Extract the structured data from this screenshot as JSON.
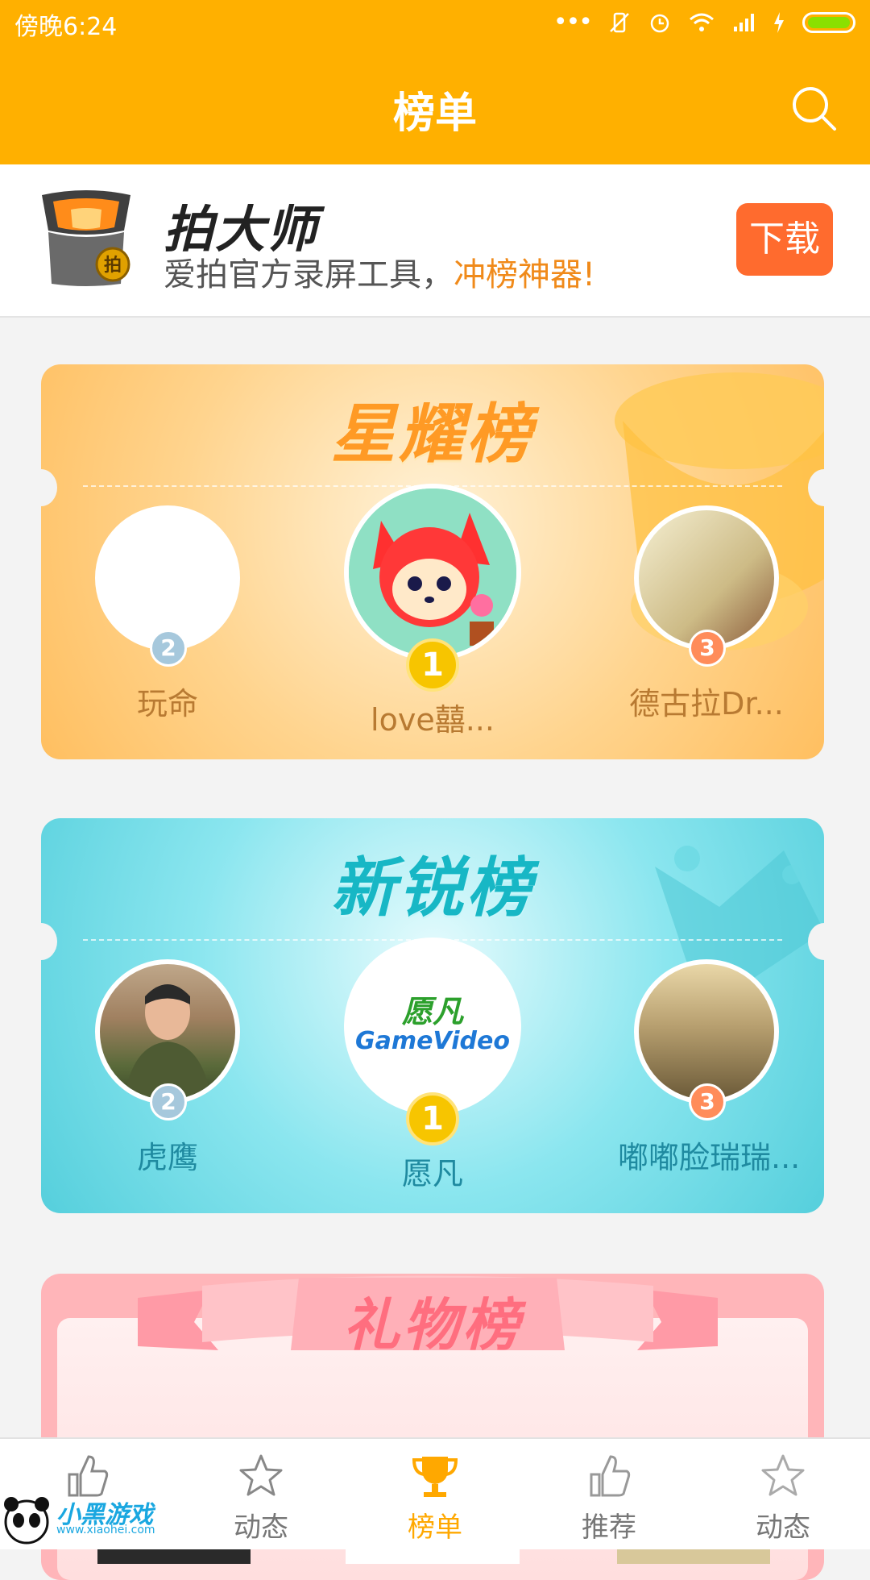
{
  "status": {
    "time": "傍晚6:24"
  },
  "header": {
    "title": "榜单"
  },
  "promo": {
    "name": "拍大师",
    "desc_main": "爱拍官方录屏工具，",
    "desc_highlight": "冲榜神器!",
    "download_label": "下载",
    "logo_badge": "拍"
  },
  "boards": [
    {
      "title": "星耀榜",
      "entries": [
        {
          "rank": "2",
          "name": "玩命"
        },
        {
          "rank": "1",
          "name": "love囍..."
        },
        {
          "rank": "3",
          "name": "德古拉Dr..."
        }
      ]
    },
    {
      "title": "新锐榜",
      "entries": [
        {
          "rank": "2",
          "name": "虎鹰"
        },
        {
          "rank": "1",
          "name": "愿凡",
          "logo_top": "愿凡",
          "logo_bottom": "GameVideo"
        },
        {
          "rank": "3",
          "name": "嘟嘟脸瑞瑞..."
        }
      ]
    },
    {
      "title": "礼物榜"
    }
  ],
  "tabs": [
    {
      "label": "",
      "icon": "thumbs-up-icon"
    },
    {
      "label": "动态",
      "icon": "star-icon"
    },
    {
      "label": "榜单",
      "icon": "trophy-icon",
      "active": true
    },
    {
      "label": "推荐",
      "icon": "thumbs-up-icon"
    },
    {
      "label": "动态",
      "icon": "star-icon"
    }
  ],
  "watermark": {
    "text": "小黑游戏",
    "url": "www.xiaohei.com"
  },
  "colors": {
    "primary": "#ffb000",
    "download": "#ff6b2e",
    "accent_text": "#f08a1a"
  }
}
